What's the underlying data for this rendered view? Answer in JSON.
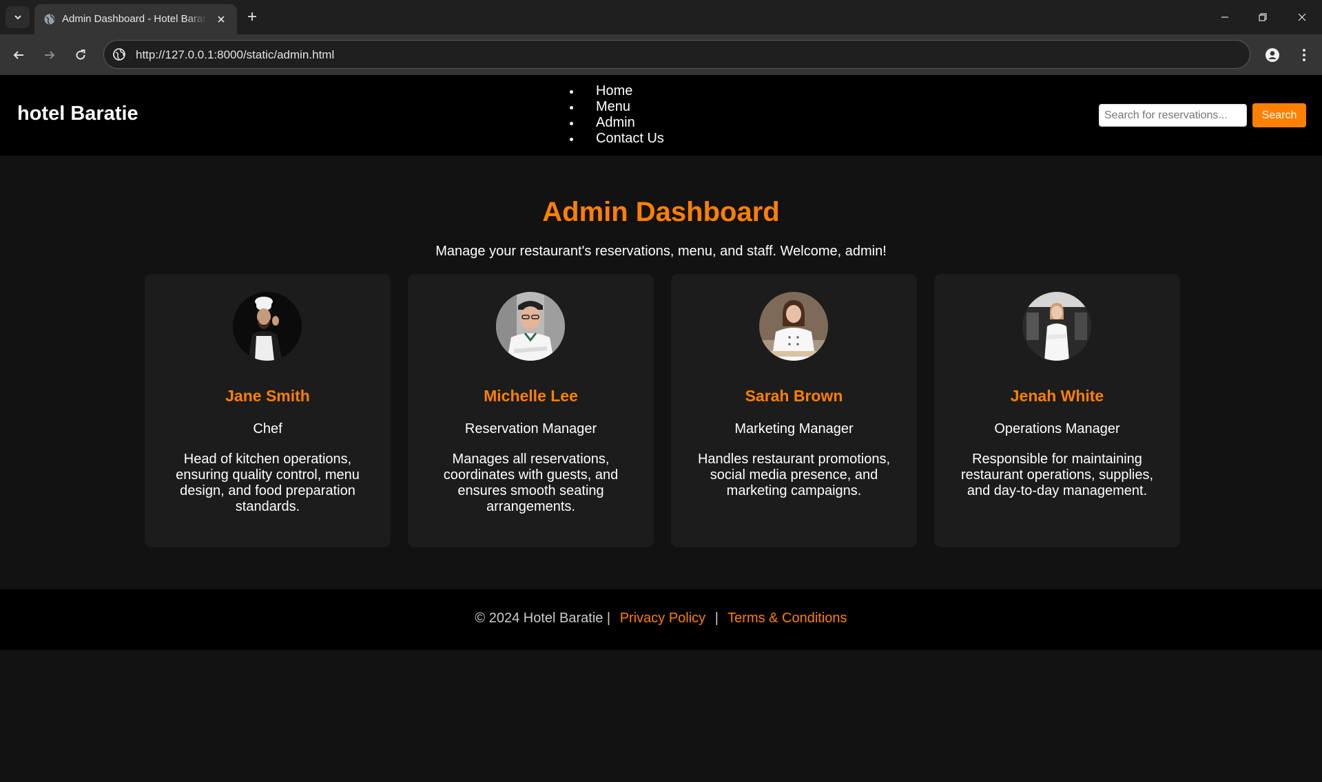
{
  "browser": {
    "tab_title": "Admin Dashboard - Hotel Baratie",
    "url": "http://127.0.0.1:8000/static/admin.html"
  },
  "header": {
    "logo": "hotel Baratie",
    "nav": [
      "Home",
      "Menu",
      "Admin",
      "Contact Us"
    ],
    "search_placeholder": "Search for reservations...",
    "search_button": "Search"
  },
  "main": {
    "title": "Admin Dashboard",
    "subtitle": "Manage your restaurant's reservations, menu, and staff. Welcome, admin!"
  },
  "staff": [
    {
      "name": "Jane Smith",
      "role": "Chef",
      "description": "Head of kitchen operations, ensuring quality control, menu design, and food preparation standards."
    },
    {
      "name": "Michelle Lee",
      "role": "Reservation Manager",
      "description": "Manages all reservations, coordinates with guests, and ensures smooth seating arrangements."
    },
    {
      "name": "Sarah Brown",
      "role": "Marketing Manager",
      "description": "Handles restaurant promotions, social media presence, and marketing campaigns."
    },
    {
      "name": "Jenah White",
      "role": "Operations Manager",
      "description": "Responsible for maintaining restaurant operations, supplies, and day-to-day management."
    }
  ],
  "footer": {
    "copyright": "© 2024 Hotel Baratie |",
    "privacy": "Privacy Policy",
    "separator": "|",
    "terms": "Terms & Conditions"
  },
  "colors": {
    "accent": "#ff8000",
    "header_bg": "#000000",
    "page_bg": "#121212",
    "card_bg": "#1c1c1c"
  }
}
